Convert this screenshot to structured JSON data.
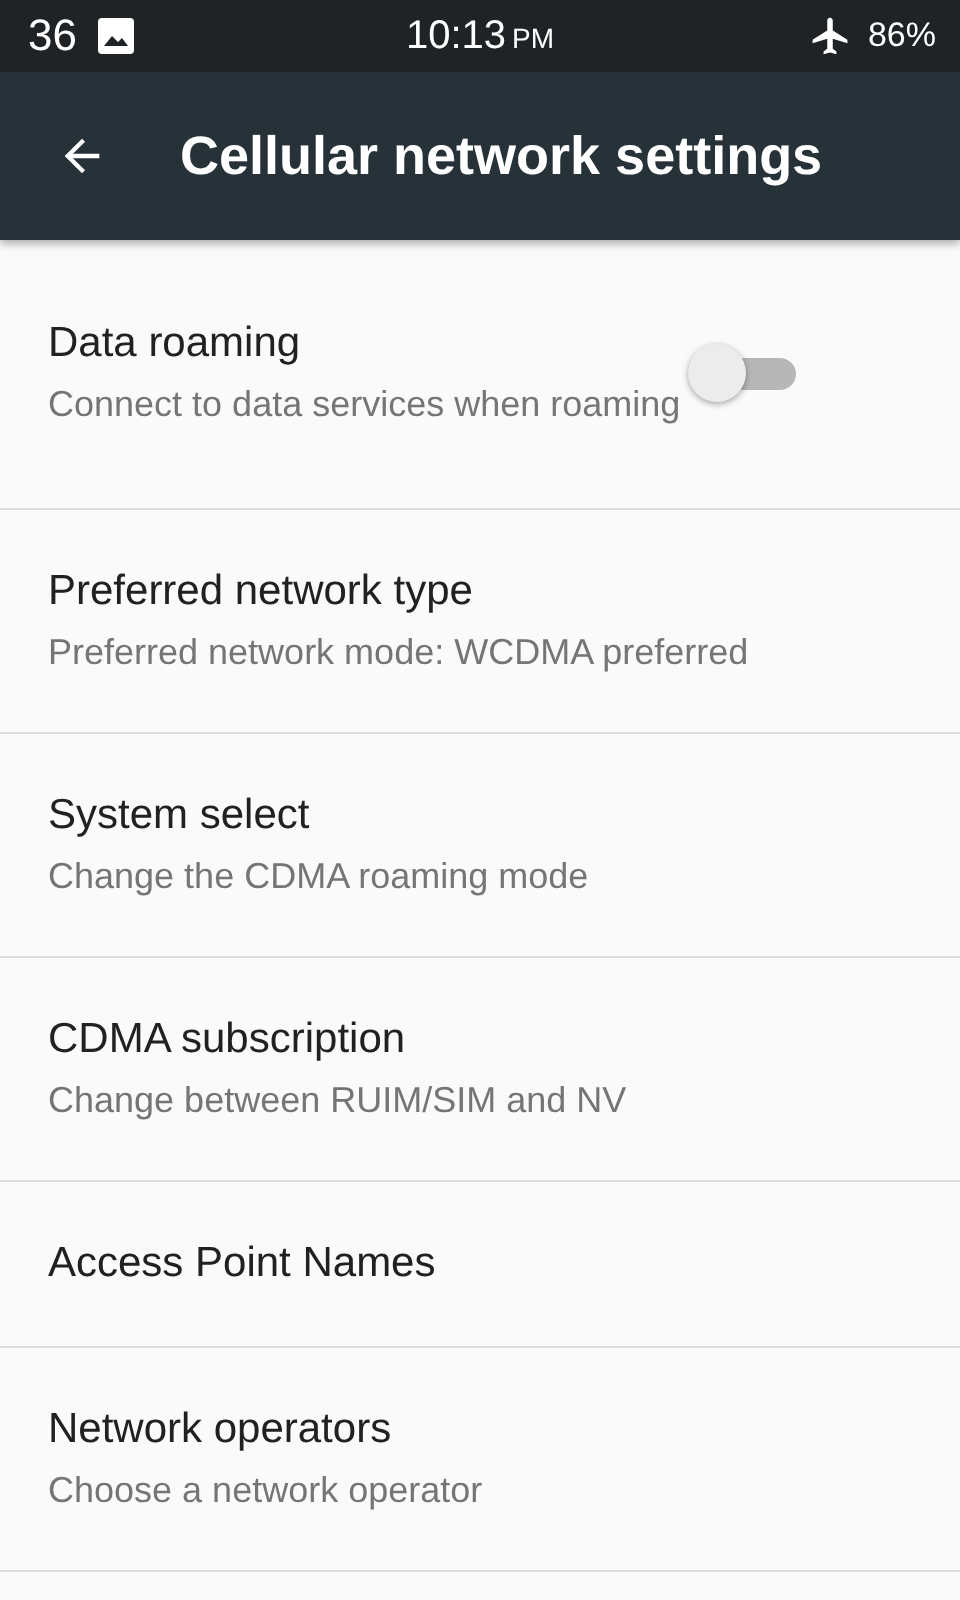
{
  "status_bar": {
    "signal_text": "36",
    "time": "10:13",
    "time_suffix": "PM",
    "battery": "86%"
  },
  "toolbar": {
    "title": "Cellular network settings"
  },
  "settings": [
    {
      "kind": "toggle",
      "title": "Data roaming",
      "summary": "Connect to data services when roaming",
      "on": false
    },
    {
      "kind": "plain",
      "title": "Preferred network type",
      "summary": "Preferred network mode: WCDMA preferred"
    },
    {
      "kind": "plain",
      "title": "System select",
      "summary": "Change the CDMA roaming mode"
    },
    {
      "kind": "plain",
      "title": "CDMA subscription",
      "summary": "Change between RUIM/SIM and NV"
    },
    {
      "kind": "plain",
      "title": "Access Point Names"
    },
    {
      "kind": "plain",
      "title": "Network operators",
      "summary": "Choose a network operator"
    }
  ]
}
